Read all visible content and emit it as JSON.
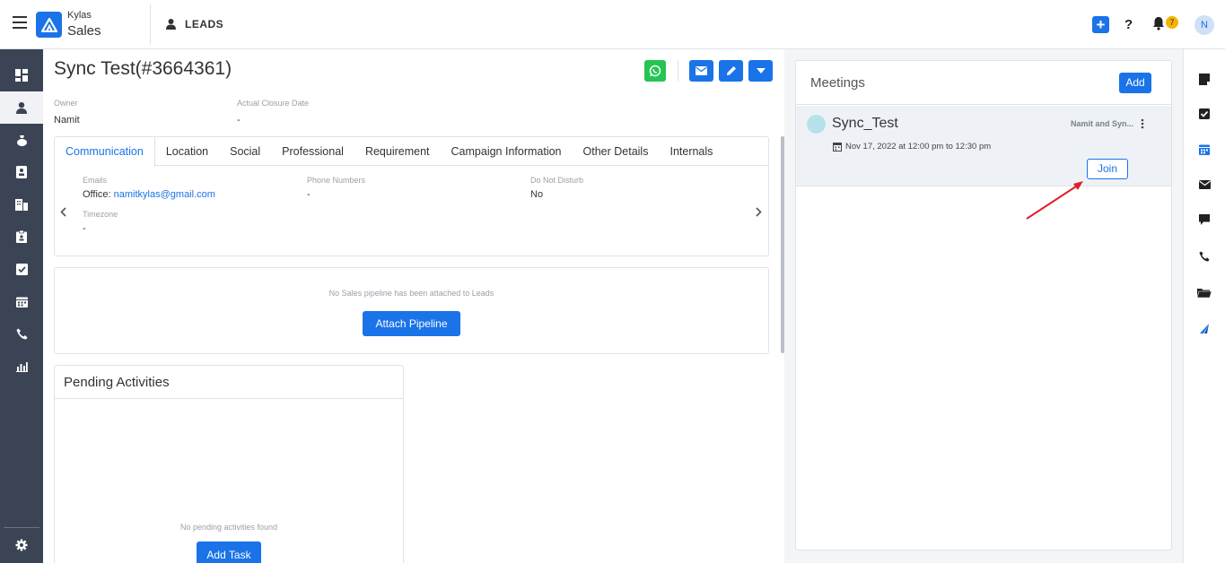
{
  "brand": {
    "line1": "Kylas",
    "line2": "Sales"
  },
  "header": {
    "module_title": "LEADS",
    "notification_count": "7",
    "user_initial": "N",
    "help": "?"
  },
  "record": {
    "title": "Sync Test(#3664361)",
    "owner_label": "Owner",
    "owner_value": "Namit",
    "closure_label": "Actual Closure Date",
    "closure_value": "-"
  },
  "tabs": [
    {
      "label": "Communication"
    },
    {
      "label": "Location"
    },
    {
      "label": "Social"
    },
    {
      "label": "Professional"
    },
    {
      "label": "Requirement"
    },
    {
      "label": "Campaign Information"
    },
    {
      "label": "Other Details"
    },
    {
      "label": "Internals"
    }
  ],
  "communication": {
    "emails_label": "Emails",
    "emails_prefix": "Office:",
    "emails_value": "namitkylas@gmail.com",
    "phones_label": "Phone Numbers",
    "phones_value": "-",
    "dnd_label": "Do Not Disturb",
    "dnd_value": "No",
    "timezone_label": "Timezone",
    "timezone_value": "-"
  },
  "pipeline": {
    "message": "No Sales pipeline has been attached to Leads",
    "button": "Attach Pipeline"
  },
  "pending": {
    "title": "Pending Activities",
    "message": "No pending activities found",
    "button": "Add Task"
  },
  "meetings": {
    "title": "Meetings",
    "add_button": "Add",
    "items": [
      {
        "title": "Sync_Test",
        "participants": "Namit and Syn...",
        "time": "Nov 17, 2022 at 12:00 pm to 12:30 pm",
        "join_button": "Join"
      }
    ]
  },
  "colors": {
    "primary": "#1a73e8",
    "nav_bg": "#3b4454",
    "whatsapp": "#25c454",
    "badge": "#f5b400",
    "arrow": "#e0202a"
  }
}
